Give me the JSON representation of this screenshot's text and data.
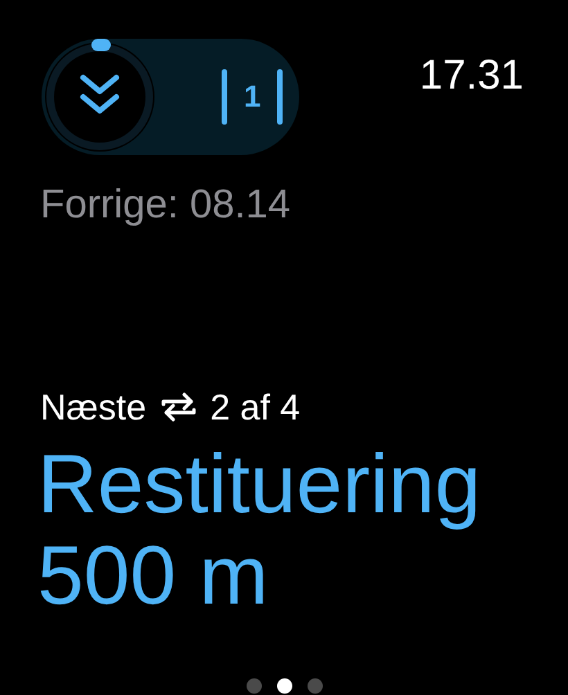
{
  "segment_control": {
    "counter": "1"
  },
  "time": "17.31",
  "previous": "Forrige: 08.14",
  "next": {
    "label": "Næste",
    "count": "2 af 4"
  },
  "interval": {
    "name": "Restituering",
    "distance": "500 m"
  },
  "pages": [
    {
      "selected": false
    },
    {
      "selected": true
    },
    {
      "selected": false
    }
  ]
}
